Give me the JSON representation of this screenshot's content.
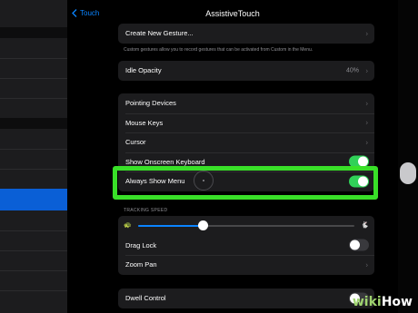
{
  "nav": {
    "back_label": "Touch",
    "title": "AssistiveTouch"
  },
  "gestures": {
    "create_label": "Create New Gesture...",
    "footer": "Custom gestures allow you to record gestures that can be activated from Custom in the Menu."
  },
  "idle": {
    "label": "Idle Opacity",
    "value": "40%"
  },
  "pointer": {
    "items": [
      {
        "label": "Pointing Devices"
      },
      {
        "label": "Mouse Keys"
      },
      {
        "label": "Cursor"
      },
      {
        "label": "Show Onscreen Keyboard",
        "toggle": "on"
      },
      {
        "label": "Always Show Menu",
        "toggle": "on"
      }
    ]
  },
  "tracking": {
    "header": "TRACKING SPEED",
    "speed_fraction": 0.3,
    "drag_lock_label": "Drag Lock",
    "drag_lock_toggle": "off",
    "zoom_pan_label": "Zoom Pan"
  },
  "dwell": {
    "label": "Dwell Control",
    "toggle": "off"
  },
  "watermark": {
    "wiki": "wiki",
    "how": "How"
  },
  "colors": {
    "accent": "#0a84ff",
    "toggle_on": "#30d158",
    "highlight": "#39e028"
  }
}
